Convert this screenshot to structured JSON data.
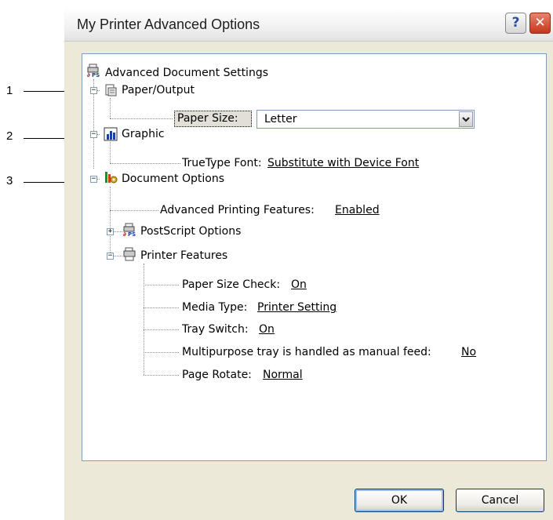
{
  "callouts": [
    "1",
    "2",
    "3"
  ],
  "window": {
    "title": "My Printer Advanced Options",
    "help_label": "?",
    "close_label": "✕"
  },
  "tree": {
    "root": "Advanced Document Settings",
    "paper_output": {
      "label": "Paper/Output",
      "paper_size_label": "Paper Size:",
      "paper_size_value": "Letter"
    },
    "graphic": {
      "label": "Graphic",
      "truetype_label": "TrueType Font:",
      "truetype_value": "Substitute with Device Font"
    },
    "document_options": {
      "label": "Document Options",
      "advanced_printing_label": "Advanced Printing Features:",
      "advanced_printing_value": "Enabled",
      "postscript_label": "PostScript Options",
      "printer_features_label": "Printer Features",
      "features": [
        {
          "label": "Paper Size Check:",
          "value": "On"
        },
        {
          "label": "Media Type:",
          "value": "Printer Setting"
        },
        {
          "label": "Tray Switch:",
          "value": "On"
        },
        {
          "label": "Multipurpose tray is handled as manual feed:",
          "value": "No"
        },
        {
          "label": "Page Rotate:",
          "value": "Normal"
        }
      ]
    }
  },
  "buttons": {
    "ok": "OK",
    "cancel": "Cancel"
  }
}
